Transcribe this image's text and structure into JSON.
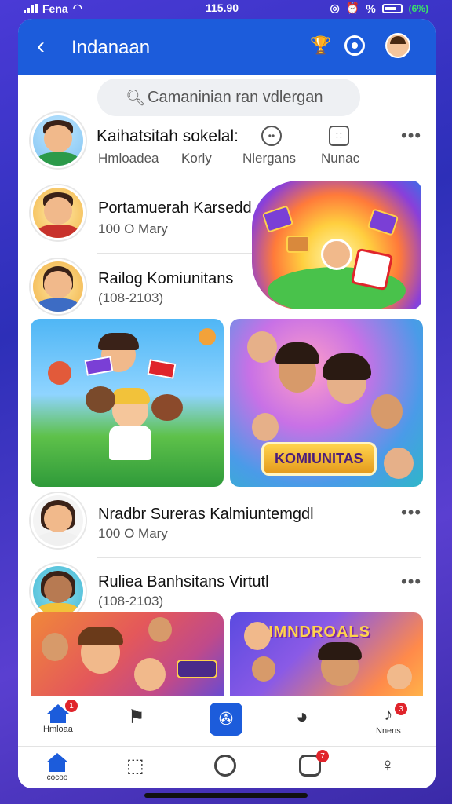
{
  "status_bar": {
    "carrier": "Fena",
    "time": "115.90",
    "percent": "%",
    "battery": "(6%)"
  },
  "header": {
    "title": "Indanaan",
    "icons": [
      "back-arrow-icon",
      "trophy-icon",
      "settings-icon",
      "profile-avatar-icon"
    ]
  },
  "search": {
    "placeholder": "Camaninian ran vdlergan"
  },
  "profile": {
    "title": "Kaihatsitah sokelal:",
    "tabs": [
      "Hmloadea",
      "Korly",
      "Nlergans",
      "Nunac"
    ]
  },
  "feed": [
    {
      "name": "Portamuerah Karsedd",
      "meta": "100 O Mary"
    },
    {
      "name": "Railog Komiunitans",
      "meta": "(108-2103)"
    },
    {
      "name": "Nradbr Sureras Kalmiuntemgdl",
      "meta": "100 O Mary"
    },
    {
      "name": "Ruliea Banhsitans Virtutl",
      "meta": "(108-2103)"
    }
  ],
  "cards": {
    "komunitas_label": "KOMIUNITAS",
    "bottom_right_label": "NMNDROALS"
  },
  "bottom_tabs": [
    {
      "label": "Hmloaa",
      "icon": "home-icon",
      "badge": "1"
    },
    {
      "label": "",
      "icon": "flag-icon",
      "badge": ""
    },
    {
      "label": "",
      "icon": "app-icon",
      "badge": ""
    },
    {
      "label": "",
      "icon": "user-icon",
      "badge": ""
    },
    {
      "label": "Nnens",
      "icon": "bell-icon",
      "badge": "3"
    }
  ],
  "bottom_nav": [
    {
      "label": "cocoo",
      "icon": "home-icon",
      "badge": ""
    },
    {
      "label": "",
      "icon": "search-icon",
      "badge": ""
    },
    {
      "label": "",
      "icon": "circle-icon",
      "badge": ""
    },
    {
      "label": "",
      "icon": "camera-icon",
      "badge": "7"
    },
    {
      "label": "",
      "icon": "profile-icon",
      "badge": ""
    }
  ],
  "colors": {
    "accent": "#1c5cdb",
    "badge": "#e0242b",
    "background": "#3a2eb8"
  }
}
